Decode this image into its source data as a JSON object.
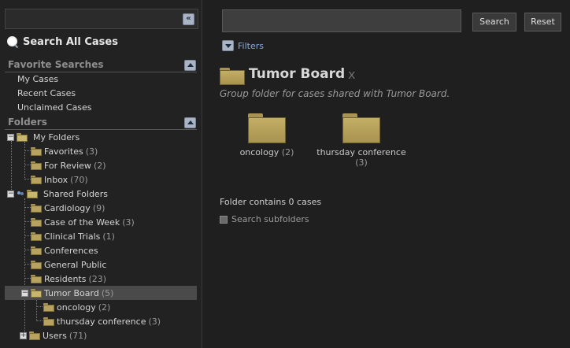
{
  "sidebar": {
    "search_all_label": "Search All Cases",
    "favorite_searches": {
      "heading": "Favorite Searches",
      "items": [
        "My Cases",
        "Recent Cases",
        "Unclaimed Cases"
      ]
    },
    "folders": {
      "heading": "Folders",
      "my_folders": {
        "label": "My Folders",
        "children": [
          {
            "label": "Favorites",
            "count": "(3)"
          },
          {
            "label": "For Review",
            "count": "(2)"
          },
          {
            "label": "Inbox",
            "count": "(70)"
          }
        ]
      },
      "shared_folders": {
        "label": "Shared Folders",
        "children": [
          {
            "label": "Cardiology",
            "count": "(9)"
          },
          {
            "label": "Case of the Week",
            "count": "(3)"
          },
          {
            "label": "Clinical Trials",
            "count": "(1)"
          },
          {
            "label": "Conferences",
            "count": ""
          },
          {
            "label": "General Public",
            "count": ""
          },
          {
            "label": "Residents",
            "count": "(23)"
          },
          {
            "label": "Tumor Board",
            "count": "(5)"
          },
          {
            "label": "oncology",
            "count": "(2)"
          },
          {
            "label": "thursday conference",
            "count": "(3)"
          },
          {
            "label": "Users",
            "count": "(71)"
          }
        ]
      }
    }
  },
  "toolbar": {
    "search_value": "",
    "search_button": "Search",
    "reset_button": "Reset",
    "filters_label": "Filters"
  },
  "folder_view": {
    "title": "Tumor Board",
    "close_glyph": "x",
    "description": "Group folder for cases shared with Tumor Board.",
    "subfolders": [
      {
        "name": "oncology",
        "count": "(2)"
      },
      {
        "name": "thursday conference",
        "count": "(3)"
      }
    ],
    "contains_text": "Folder contains 0 cases",
    "search_subfolders_label": "Search subfolders"
  },
  "colors": {
    "background": "#1f1f1f",
    "selected_row": "#4a4a4a",
    "folder": "#b7a35f",
    "link": "#8aa8d8"
  }
}
